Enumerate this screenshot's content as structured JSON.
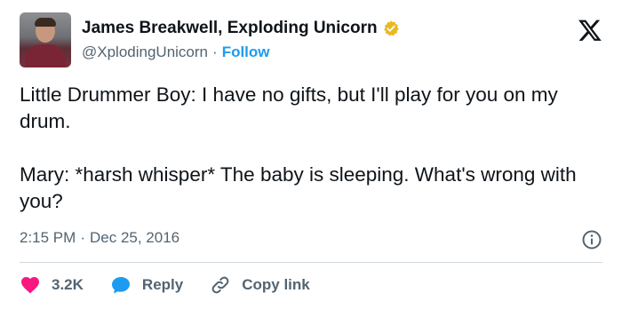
{
  "author": {
    "display_name": "James Breakwell, Exploding Unicorn",
    "handle": "@XplodingUnicorn",
    "separator": "·",
    "follow_label": "Follow",
    "verified_color": "#e8b923"
  },
  "tweet": {
    "text": "Little Drummer Boy: I have no gifts, but I'll play for you on my drum.\n\nMary: *harsh whisper* The baby is sleeping. What's wrong with you?",
    "time": "2:15 PM",
    "date_separator": "·",
    "date": "Dec 25, 2016"
  },
  "actions": {
    "likes_count": "3.2K",
    "reply_label": "Reply",
    "copy_link_label": "Copy link"
  },
  "colors": {
    "like": "#f91880",
    "reply": "#1d9bf0",
    "link": "#1d9bf0",
    "muted": "#536471",
    "text": "#0f1419"
  },
  "icons": [
    "x-logo-icon",
    "verified-badge-icon",
    "info-icon",
    "heart-icon",
    "reply-bubble-icon",
    "link-icon"
  ]
}
